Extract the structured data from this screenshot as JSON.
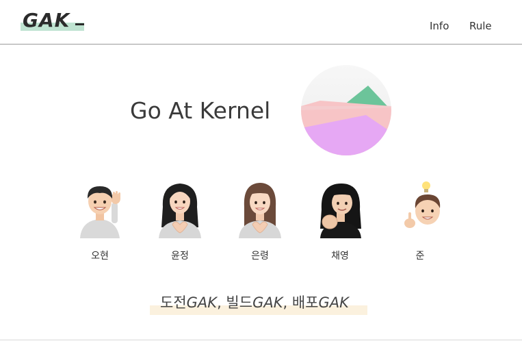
{
  "header": {
    "logo_text": "GAK",
    "nav": [
      {
        "label": "Info"
      },
      {
        "label": "Rule"
      }
    ]
  },
  "hero": {
    "title": "Go At Kernel"
  },
  "members": [
    {
      "name": "오현",
      "icon": "memoji-waving-boy"
    },
    {
      "name": "윤정",
      "icon": "memoji-heart-hands-girl"
    },
    {
      "name": "은령",
      "icon": "memoji-heart-hands-girl"
    },
    {
      "name": "채영",
      "icon": "memoji-fist-girl"
    },
    {
      "name": "준",
      "icon": "memoji-lightbulb-boy"
    }
  ],
  "slogan": {
    "part1": "도전",
    "gak1": "GAK",
    "sep1": ", ",
    "part2": "빌드",
    "gak2": "GAK",
    "sep2": ", ",
    "part3": "배포",
    "gak3": "GAK"
  },
  "colors": {
    "logo_highlight": "#bfe3d1",
    "slogan_highlight": "#fbf1de",
    "circle_green": "#6cc49a",
    "circle_pink": "#f7c4c6",
    "circle_purple": "#e6a8f4"
  }
}
